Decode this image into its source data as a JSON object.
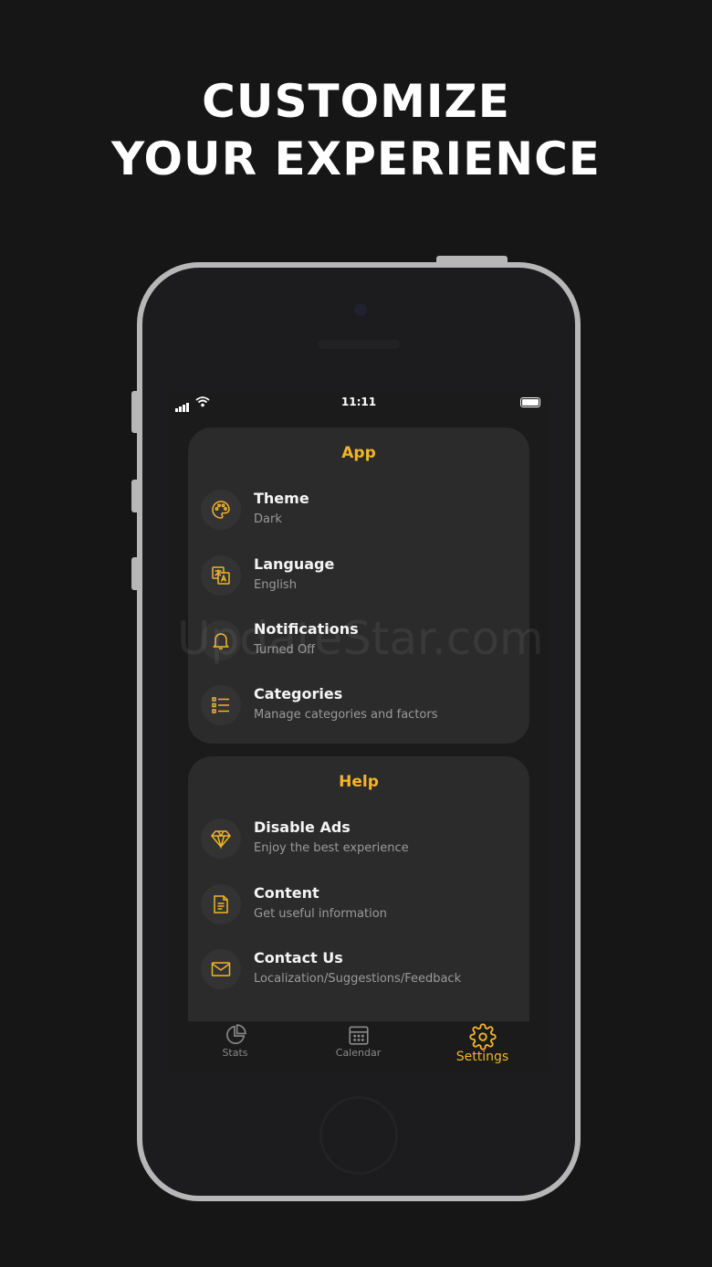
{
  "headline": {
    "line1": "CUSTOMIZE",
    "line2": "YOUR EXPERIENCE"
  },
  "status": {
    "time": "11:11"
  },
  "colors": {
    "accent": "#f2b42a",
    "card": "#2b2b2b",
    "background": "#161616"
  },
  "sections": [
    {
      "title": "App",
      "items": [
        {
          "icon": "palette-icon",
          "title": "Theme",
          "subtitle": "Dark"
        },
        {
          "icon": "translate-icon",
          "title": "Language",
          "subtitle": "English"
        },
        {
          "icon": "bell-icon",
          "title": "Notifications",
          "subtitle": "Turned Off"
        },
        {
          "icon": "list-icon",
          "title": "Categories",
          "subtitle": "Manage categories and factors"
        }
      ]
    },
    {
      "title": "Help",
      "items": [
        {
          "icon": "diamond-icon",
          "title": "Disable Ads",
          "subtitle": "Enjoy the best experience"
        },
        {
          "icon": "document-icon",
          "title": "Content",
          "subtitle": "Get useful information"
        },
        {
          "icon": "mail-icon",
          "title": "Contact Us",
          "subtitle": "Localization/Suggestions/Feedback"
        }
      ]
    }
  ],
  "watermark": "UpdateStar.com",
  "tabs": [
    {
      "icon": "pie-chart-icon",
      "label": "Stats"
    },
    {
      "icon": "calendar-icon",
      "label": "Calendar"
    },
    {
      "icon": "gear-icon",
      "label": "Settings",
      "active": true
    }
  ]
}
